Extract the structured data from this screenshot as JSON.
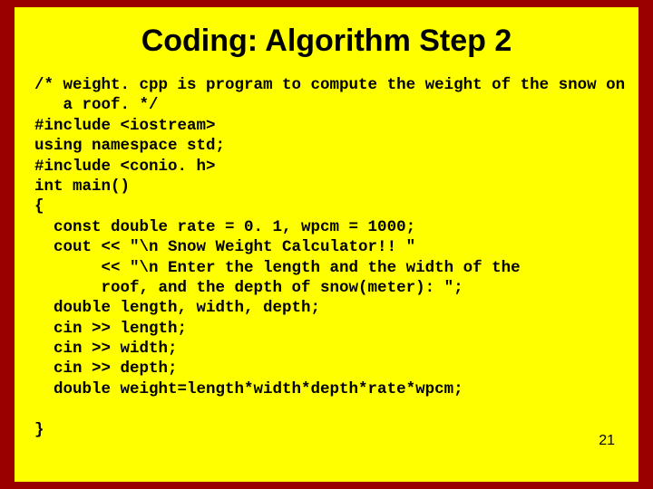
{
  "title": "Coding: Algorithm Step 2",
  "code": [
    "/* weight. cpp is program to compute the weight of the snow on",
    "   a roof. */",
    "#include <iostream>",
    "using namespace std;",
    "#include <conio. h>",
    "int main()",
    "{",
    "  const double rate = 0. 1, wpcm = 1000;",
    "  cout << \"\\n Snow Weight Calculator!! \"",
    "       << \"\\n Enter the length and the width of the",
    "       roof, and the depth of snow(meter): \";",
    "  double length, width, depth;",
    "  cin >> length;",
    "  cin >> width;",
    "  cin >> depth;",
    "  double weight=length*width*depth*rate*wpcm;",
    "",
    "}"
  ],
  "page_number": "21"
}
